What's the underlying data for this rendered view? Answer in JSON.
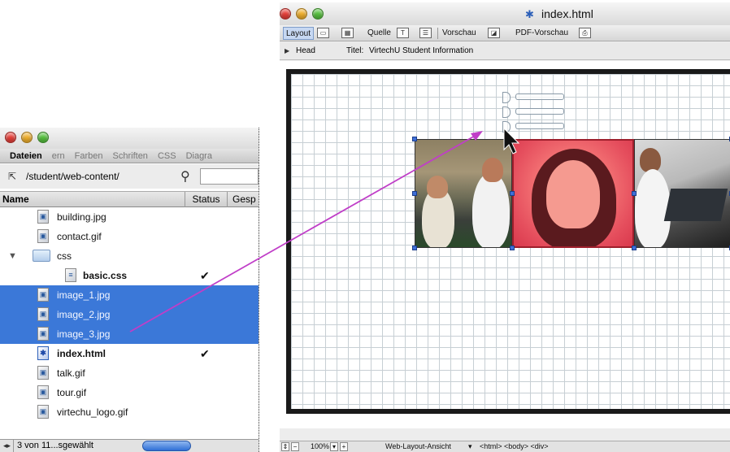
{
  "files_panel": {
    "tabs": [
      "Dateien",
      "ern",
      "Farben",
      "Schriften",
      "CSS",
      "Diagra"
    ],
    "path": "/student/web-content/",
    "search_placeholder": "",
    "columns": {
      "name": "Name",
      "status": "Status",
      "gesp": "Gesp"
    },
    "files": [
      {
        "name": "building.jpg",
        "type": "image"
      },
      {
        "name": "contact.gif",
        "type": "image"
      },
      {
        "name": "css",
        "type": "folder"
      },
      {
        "name": "basic.css",
        "type": "css",
        "checked": "✔"
      },
      {
        "name": "image_1.jpg",
        "type": "image"
      },
      {
        "name": "image_2.jpg",
        "type": "image"
      },
      {
        "name": "image_3.jpg",
        "type": "image"
      },
      {
        "name": "index.html",
        "type": "html",
        "checked": "✔"
      },
      {
        "name": "talk.gif",
        "type": "image"
      },
      {
        "name": "tour.gif",
        "type": "image"
      },
      {
        "name": "virtechu_logo.gif",
        "type": "image"
      }
    ],
    "footer_text": "3 von 11...sgewählt"
  },
  "document": {
    "title": "index.html",
    "toolbar": {
      "layout": "Layout",
      "quelle": "Quelle",
      "vorschau": "Vorschau",
      "pdf_vorschau": "PDF-Vorschau"
    },
    "head_label": "Head",
    "title_label": "Titel:",
    "title_value": "VirtechU Student Information",
    "status": {
      "zoom": "100%",
      "view_mode": "Web-Layout-Ansicht",
      "tags": "<html> <body> <div>"
    }
  },
  "colors": {
    "selection": "#3b78d8",
    "drag_arrow": "#c03ec8",
    "photo_highlight": "#f26f72"
  }
}
